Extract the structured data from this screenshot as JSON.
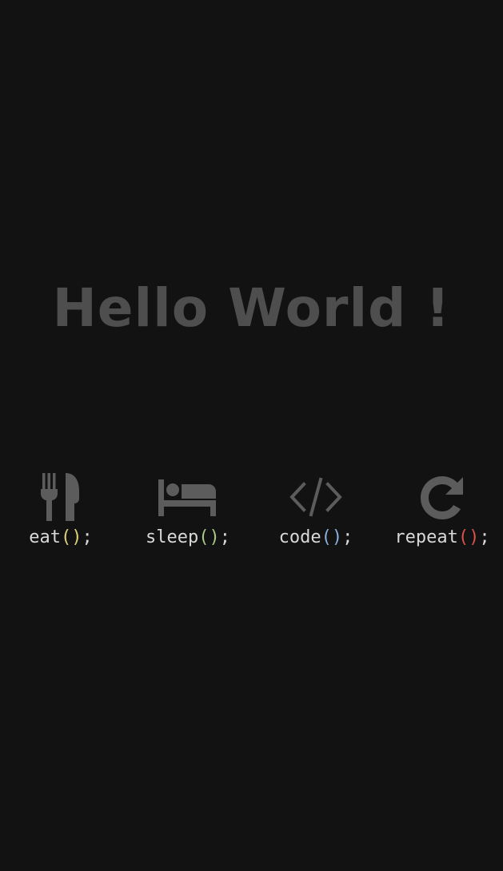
{
  "headline": "Hello World !",
  "colors": {
    "background": "#121213",
    "headline": "#4e4e4f",
    "icon": "#5c5c5d",
    "text": "#d8d8d8"
  },
  "routine": [
    {
      "icon": "fork-knife-icon",
      "name": "eat",
      "parens": "()",
      "semicolon": ";",
      "paren_color": "#e0d27a"
    },
    {
      "icon": "bed-icon",
      "name": "sleep",
      "parens": "()",
      "semicolon": ";",
      "paren_color": "#a9c98a"
    },
    {
      "icon": "code-brackets-icon",
      "name": "code",
      "parens": "()",
      "semicolon": ";",
      "paren_color": "#8ab0e0"
    },
    {
      "icon": "redo-arrow-icon",
      "name": "repeat",
      "parens": "()",
      "semicolon": ";",
      "paren_color": "#d9534f"
    }
  ]
}
